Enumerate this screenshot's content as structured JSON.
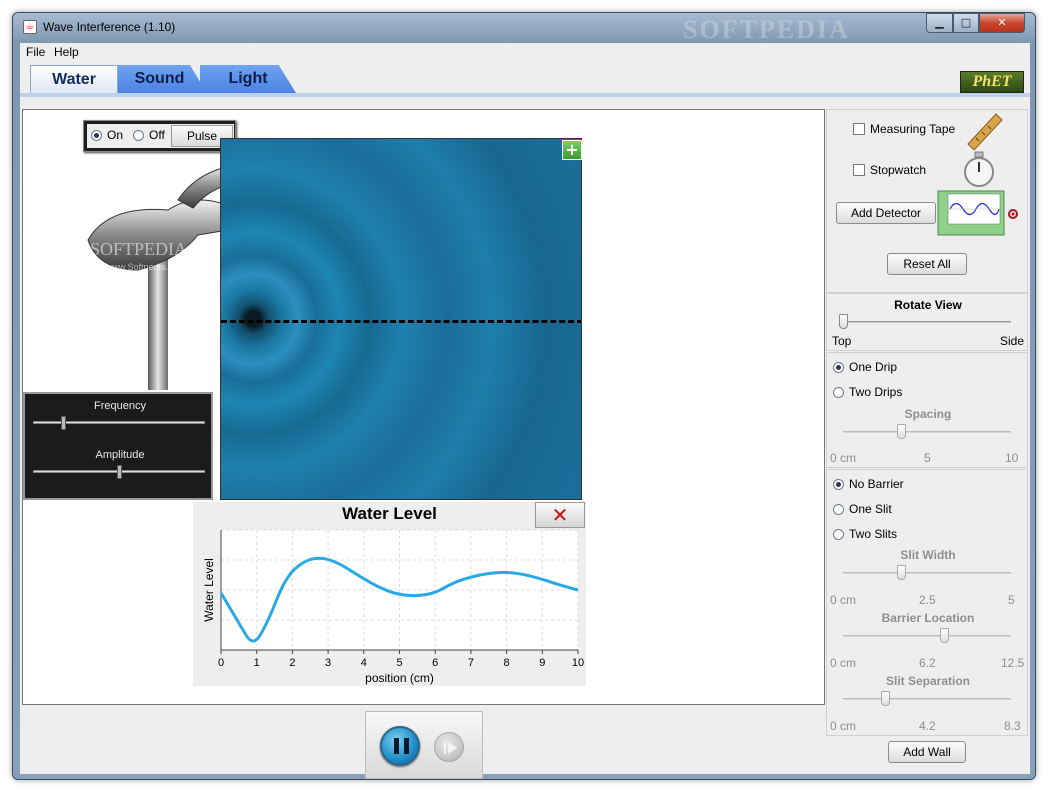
{
  "window": {
    "title": "Wave Interference (1.10)",
    "watermark": "SOFTPEDIA"
  },
  "menu": {
    "file": "File",
    "help": "Help"
  },
  "tabs": {
    "water": "Water",
    "sound": "Sound",
    "light": "Light"
  },
  "logo": "PhET",
  "source": {
    "on_label": "On",
    "off_label": "Off",
    "on_selected": true,
    "pulse_label": "Pulse",
    "faucet_watermark": "SOFTPEDIA",
    "faucet_watermark_small": "www.Softpedia.com"
  },
  "controls": {
    "frequency_label": "Frequency",
    "amplitude_label": "Amplitude",
    "frequency_value": 0.17,
    "amplitude_value": 0.5
  },
  "graph": {
    "title": "Water Level",
    "close_symbol": "✕",
    "xlabel": "position (cm)",
    "ylabel": "Water Level"
  },
  "chart_data": {
    "type": "line",
    "title": "Water Level",
    "xlabel": "position (cm)",
    "ylabel": "Water Level",
    "xlim": [
      0,
      10
    ],
    "ylim": [
      -1,
      1
    ],
    "xticks": [
      "0",
      "1",
      "2",
      "3",
      "4",
      "5",
      "6",
      "7",
      "8",
      "9",
      "10"
    ],
    "grid": true,
    "series": [
      {
        "color": "#29a8e6",
        "x": [
          0,
          0.5,
          0.9,
          1.3,
          1.8,
          2.3,
          2.8,
          3.3,
          3.9,
          4.5,
          5.0,
          5.5,
          6.0,
          6.5,
          7.0,
          7.5,
          8.0,
          8.5,
          9.0,
          9.5,
          10.0
        ],
        "y": [
          -0.05,
          -0.55,
          -0.95,
          -0.55,
          0.2,
          0.48,
          0.55,
          0.45,
          0.22,
          0.02,
          -0.08,
          -0.1,
          -0.05,
          0.12,
          0.22,
          0.28,
          0.3,
          0.26,
          0.18,
          0.08,
          0.0
        ]
      }
    ]
  },
  "sidebar": {
    "measuring_tape": "Measuring Tape",
    "stopwatch": "Stopwatch",
    "add_detector": "Add Detector",
    "reset_all": "Reset All",
    "rotate_view": "Rotate View",
    "rotate_top": "Top",
    "rotate_side": "Side",
    "rotate_value": 0.0,
    "one_drip": "One Drip",
    "two_drips": "Two Drips",
    "spacing_label": "Spacing",
    "spacing_min": "0 cm",
    "spacing_mid": "5",
    "spacing_max": "10",
    "spacing_value": 3.4,
    "no_barrier": "No Barrier",
    "one_slit": "One Slit",
    "two_slits": "Two Slits",
    "slit_width_label": "Slit Width",
    "slit_width_min": "0 cm",
    "slit_width_mid": "2.5",
    "slit_width_max": "5",
    "slit_width_value": 1.7,
    "barrier_location_label": "Barrier Location",
    "barrier_location_min": "0 cm",
    "barrier_location_mid": "6.2",
    "barrier_location_max": "12.5",
    "barrier_location_value": 7.6,
    "slit_separation_label": "Slit Separation",
    "slit_separation_min": "0 cm",
    "slit_separation_mid": "4.2",
    "slit_separation_max": "8.3",
    "slit_separation_value": 2.0,
    "add_wall": "Add Wall"
  },
  "playback": {
    "pause_icon": "pause-icon",
    "step_icon": "step-icon"
  }
}
